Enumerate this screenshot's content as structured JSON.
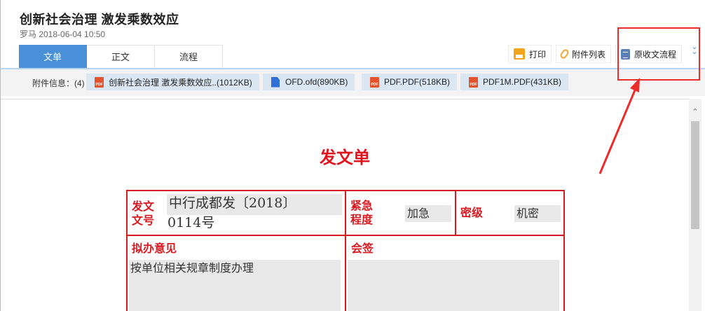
{
  "header": {
    "title": "创新社会治理 激发乘数效应",
    "meta": "罗马 2018-06-04 10:50"
  },
  "tabs": [
    {
      "label": "文单",
      "active": true
    },
    {
      "label": "正文",
      "active": false
    },
    {
      "label": "流程",
      "active": false
    }
  ],
  "toolbar": {
    "print_label": "打印",
    "attachments_label": "附件列表",
    "original_flow_label": "原收文流程"
  },
  "attachments": {
    "label": "附件信息：(4)",
    "items": [
      {
        "name": "创新社会治理 激发乘数效应..(1012KB)",
        "icon": "pdf-icon"
      },
      {
        "name": "OFD.ofd(890KB)",
        "icon": "ofd-icon"
      },
      {
        "name": "PDF.PDF(518KB)",
        "icon": "pdf-icon"
      },
      {
        "name": "PDF1M.PDF(431KB)",
        "icon": "pdf-icon"
      }
    ]
  },
  "form": {
    "title": "发文单",
    "doc_number_label_1": "发文",
    "doc_number_label_2": "文号",
    "doc_number_line_1": "中行成都发〔2018〕",
    "doc_number_line_2": "0114号",
    "urgency_label_1": "紧急",
    "urgency_label_2": "程度",
    "urgency_value": "加急",
    "secrecy_label": "密级",
    "secrecy_value": "机密",
    "draft_opinion_label": "拟办意见",
    "draft_opinion_value": "按单位相关规章制度办理",
    "countersign_label": "会签"
  },
  "colors": {
    "accent": "#4a90d9",
    "form_red": "#d71a21",
    "annotation_red": "#ec2b2b"
  }
}
